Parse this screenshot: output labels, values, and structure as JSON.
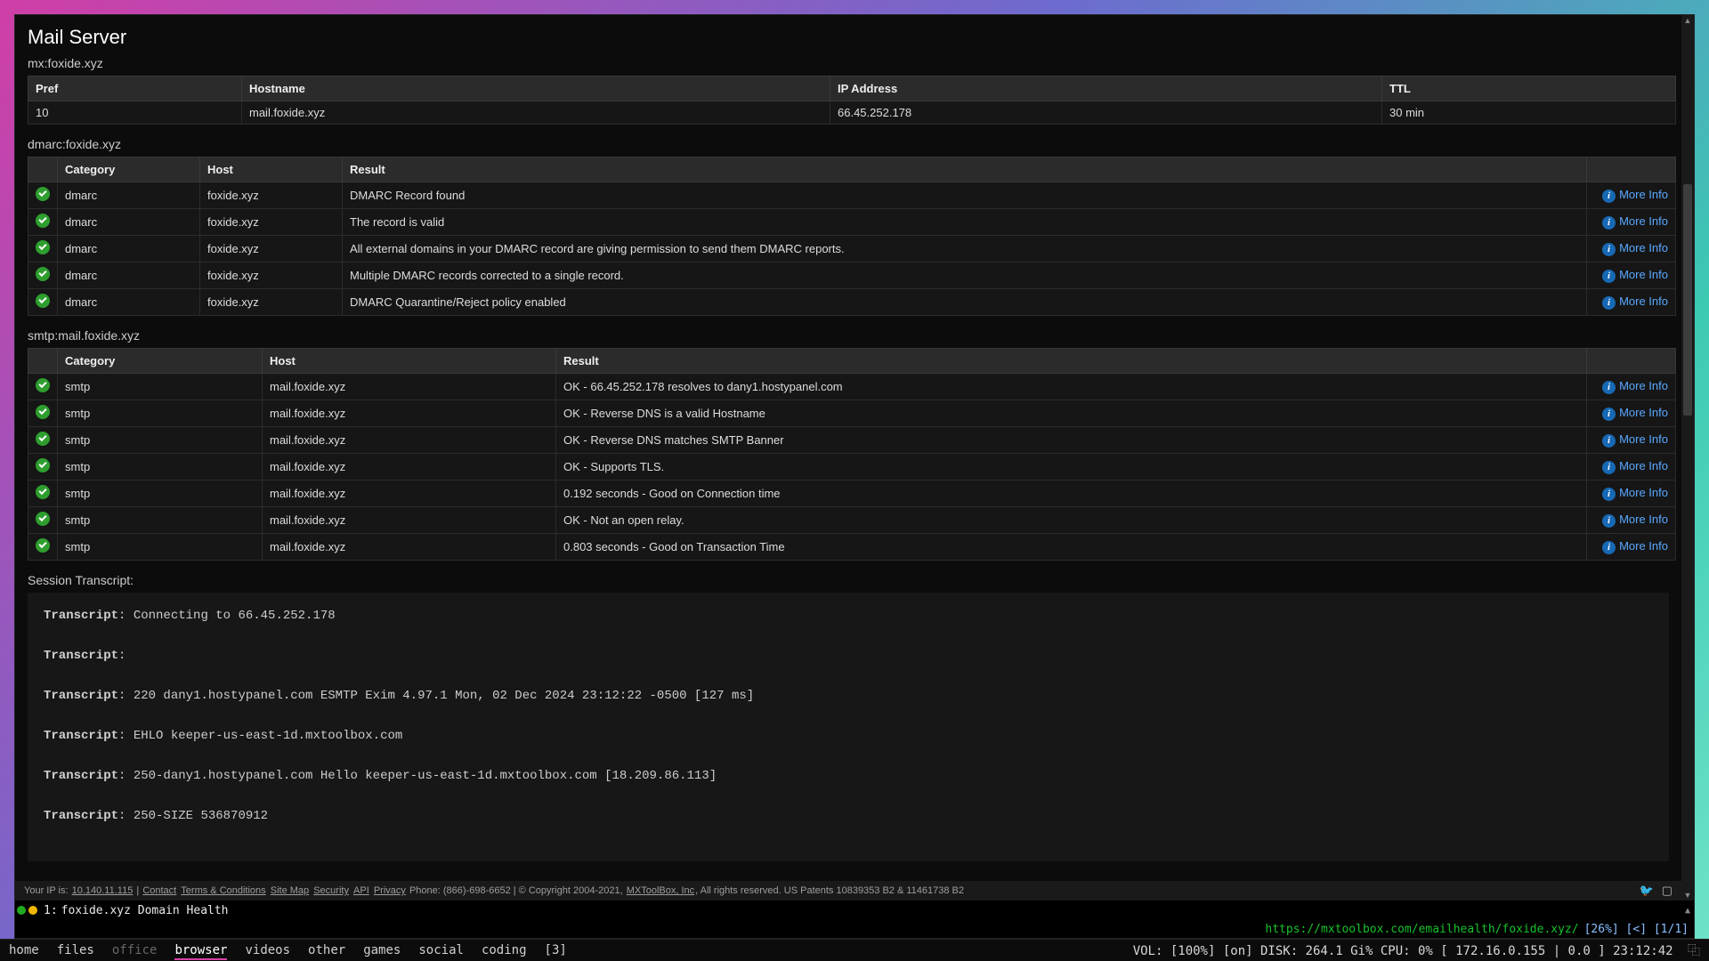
{
  "section_title": "Mail Server",
  "mx": {
    "heading": "mx:foxide.xyz",
    "headers": {
      "pref": "Pref",
      "hostname": "Hostname",
      "ip": "IP Address",
      "ttl": "TTL"
    },
    "row": {
      "pref": "10",
      "hostname": "mail.foxide.xyz",
      "ip": "66.45.252.178",
      "ttl": "30 min"
    }
  },
  "dmarc": {
    "heading": "dmarc:foxide.xyz",
    "headers": {
      "category": "Category",
      "host": "Host",
      "result": "Result"
    },
    "rows": [
      {
        "category": "dmarc",
        "host": "foxide.xyz",
        "result": "DMARC Record found"
      },
      {
        "category": "dmarc",
        "host": "foxide.xyz",
        "result": "The record is valid"
      },
      {
        "category": "dmarc",
        "host": "foxide.xyz",
        "result": "All external domains in your DMARC record are giving permission to send them DMARC reports."
      },
      {
        "category": "dmarc",
        "host": "foxide.xyz",
        "result": "Multiple DMARC records corrected to a single record."
      },
      {
        "category": "dmarc",
        "host": "foxide.xyz",
        "result": "DMARC Quarantine/Reject policy enabled"
      }
    ]
  },
  "smtp": {
    "heading": "smtp:mail.foxide.xyz",
    "headers": {
      "category": "Category",
      "host": "Host",
      "result": "Result"
    },
    "rows": [
      {
        "category": "smtp",
        "host": "mail.foxide.xyz",
        "result": "OK - 66.45.252.178 resolves to dany1.hostypanel.com"
      },
      {
        "category": "smtp",
        "host": "mail.foxide.xyz",
        "result": "OK - Reverse DNS is a valid Hostname"
      },
      {
        "category": "smtp",
        "host": "mail.foxide.xyz",
        "result": "OK - Reverse DNS matches SMTP Banner"
      },
      {
        "category": "smtp",
        "host": "mail.foxide.xyz",
        "result": "OK - Supports TLS."
      },
      {
        "category": "smtp",
        "host": "mail.foxide.xyz",
        "result": "0.192 seconds - Good on Connection time"
      },
      {
        "category": "smtp",
        "host": "mail.foxide.xyz",
        "result": "OK - Not an open relay."
      },
      {
        "category": "smtp",
        "host": "mail.foxide.xyz",
        "result": "0.803 seconds - Good on Transaction Time"
      }
    ]
  },
  "more_info_label": "More Info",
  "session": {
    "heading": "Session Transcript:",
    "label": "Transcript",
    "lines": [
      "Connecting to 66.45.252.178",
      "",
      "220 dany1.hostypanel.com ESMTP Exim 4.97.1 Mon, 02 Dec 2024 23:12:22 -0500 [127 ms]",
      "EHLO keeper-us-east-1d.mxtoolbox.com",
      "250-dany1.hostypanel.com Hello keeper-us-east-1d.mxtoolbox.com [18.209.86.113]",
      "250-SIZE 536870912"
    ]
  },
  "footer": {
    "ip_label": "Your IP is:",
    "ip": "10.140.11.115",
    "links": {
      "contact": "Contact",
      "terms": "Terms & Conditions",
      "sitemap": "Site Map",
      "security": "Security",
      "api": "API",
      "privacy": "Privacy"
    },
    "phone": "Phone: (866)-698-6652  |   © Copyright 2004-2021,",
    "company": "MXToolBox, Inc",
    "rights": ", All rights reserved. US Patents 10839353 B2 & 11461738 B2"
  },
  "tab": {
    "index": "1:",
    "title": "foxide.xyz Domain Health"
  },
  "urlrow": {
    "url": "https://mxtoolbox.com/emailhealth/foxide.xyz/",
    "metrics": "[26%] [<] [1/1]"
  },
  "taskbar": {
    "items": [
      "home",
      "files",
      "office",
      "browser",
      "videos",
      "other",
      "games",
      "social",
      "coding",
      "[3]"
    ],
    "active_index": 3,
    "dim_index": 2,
    "status": "VOL: [100%] [on] DISK: 264.1 Gi% CPU: 0%  [ 172.16.0.155 | 0.0  ]  23:12:42"
  }
}
